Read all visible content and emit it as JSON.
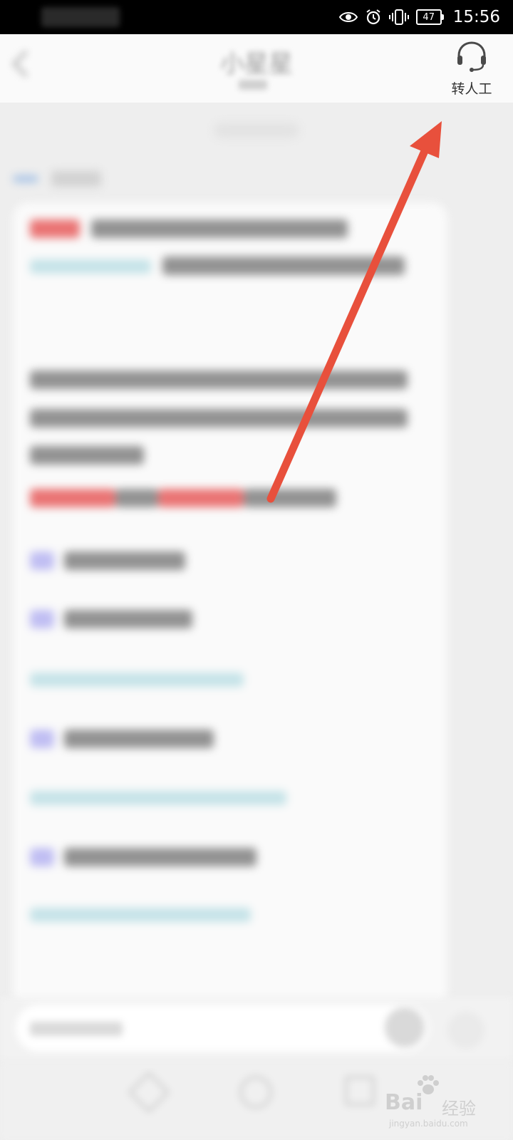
{
  "status_bar": {
    "time": "15:56",
    "battery": "47",
    "icons": [
      "eye-icon",
      "alarm-icon",
      "vibrate-icon",
      "battery-icon"
    ]
  },
  "header": {
    "title": "小星星",
    "transfer_label": "转人工",
    "icons": [
      "back-arrow-icon",
      "headset-icon"
    ]
  },
  "annotation": {
    "color": "#e8503c"
  },
  "watermark": {
    "brand": "Bai",
    "brand_suffix": "经验",
    "url": "jingyan.baidu.com"
  }
}
